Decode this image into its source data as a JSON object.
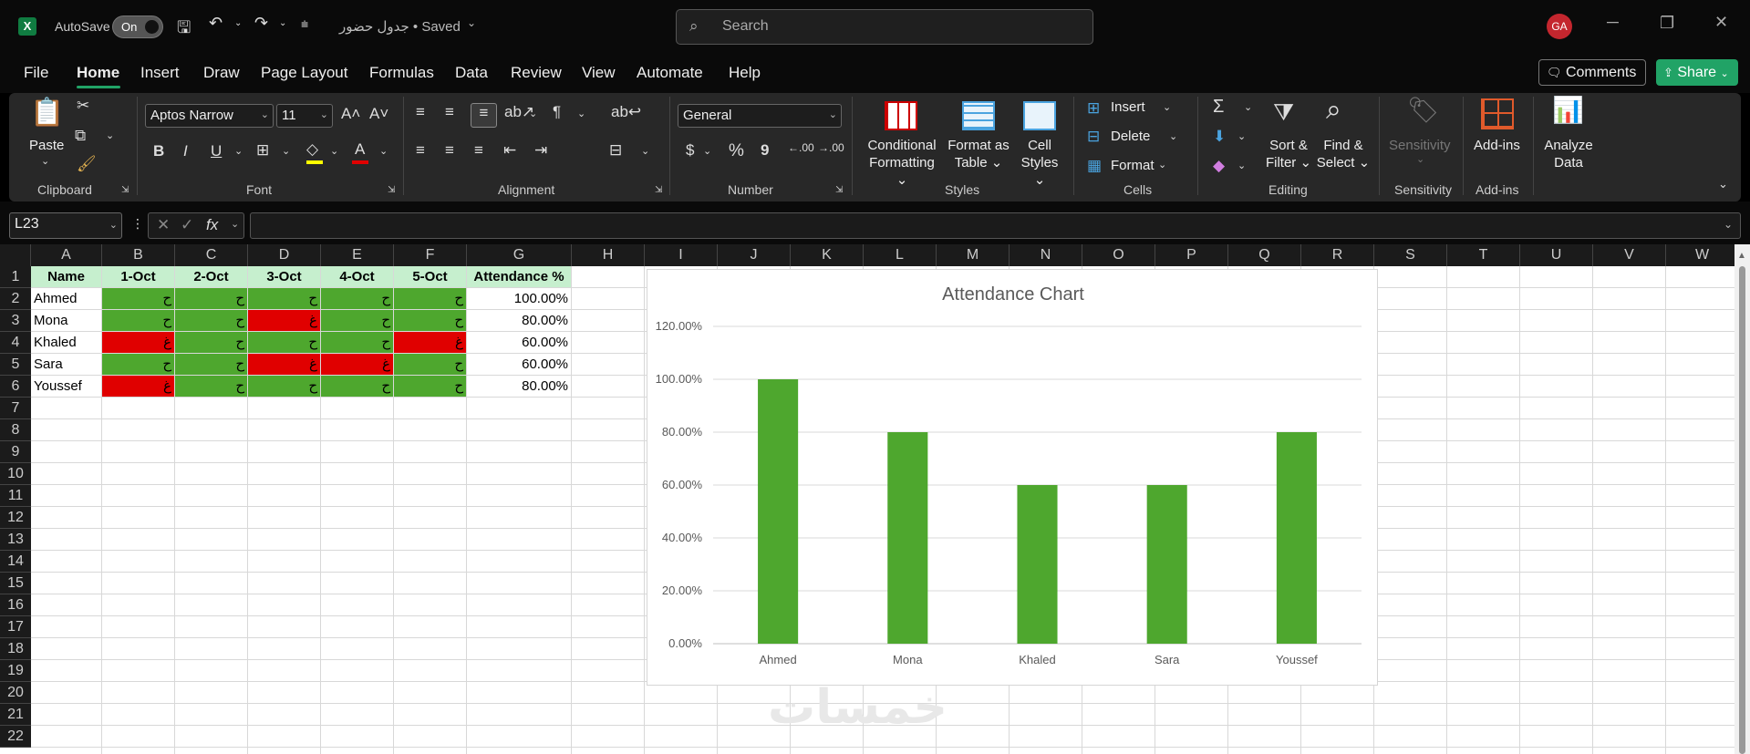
{
  "title_bar": {
    "autosave_label": "AutoSave",
    "autosave_state": "On",
    "document_title": "جدول حضور • Saved",
    "search_placeholder": "Search",
    "avatar_initials": "GA"
  },
  "menu": {
    "items": [
      "File",
      "Home",
      "Insert",
      "Draw",
      "Page Layout",
      "Formulas",
      "Data",
      "Review",
      "View",
      "Automate",
      "Help"
    ],
    "active": "Home",
    "comments_label": "Comments",
    "share_label": "Share"
  },
  "ribbon": {
    "clipboard": {
      "paste_label": "Paste",
      "group_label": "Clipboard"
    },
    "font": {
      "family": "Aptos Narrow",
      "size": "11",
      "group_label": "Font",
      "bold": "B",
      "italic": "I",
      "underline": "U"
    },
    "alignment": {
      "group_label": "Alignment"
    },
    "number": {
      "format": "General",
      "currency": "$",
      "percent": "%",
      "comma": "9",
      "inc_decimal": ".00",
      "dec_decimal": ".00",
      "group_label": "Number"
    },
    "styles": {
      "conditional_l1": "Conditional",
      "conditional_l2": "Formatting",
      "format_table_l1": "Format as",
      "format_table_l2": "Table",
      "cell_styles_l1": "Cell",
      "cell_styles_l2": "Styles",
      "group_label": "Styles"
    },
    "cells": {
      "insert": "Insert",
      "delete": "Delete",
      "format": "Format",
      "group_label": "Cells"
    },
    "editing": {
      "sort_l1": "Sort &",
      "sort_l2": "Filter",
      "find_l1": "Find &",
      "find_l2": "Select",
      "group_label": "Editing"
    },
    "sensitivity": {
      "label": "Sensitivity",
      "group_label": "Sensitivity"
    },
    "addins": {
      "label": "Add-ins",
      "group_label": "Add-ins"
    },
    "analyze": {
      "l1": "Analyze",
      "l2": "Data"
    }
  },
  "formula_bar": {
    "name_box": "L23",
    "fx": "fx",
    "formula": ""
  },
  "sheet": {
    "columns": [
      "A",
      "B",
      "C",
      "D",
      "E",
      "F",
      "G",
      "H",
      "I",
      "J",
      "K",
      "L",
      "M",
      "N",
      "O",
      "P",
      "Q",
      "R",
      "S",
      "T",
      "U",
      "V",
      "W"
    ],
    "rows": [
      "1",
      "2",
      "3",
      "4",
      "5",
      "6",
      "7",
      "8",
      "9",
      "10",
      "11",
      "12",
      "13",
      "14",
      "15",
      "16",
      "17",
      "18",
      "19",
      "20",
      "21",
      "22"
    ],
    "headers": [
      "Name",
      "1-Oct",
      "2-Oct",
      "3-Oct",
      "4-Oct",
      "5-Oct",
      "Attendance %"
    ],
    "present_mark": "ح",
    "absent_mark": "غ",
    "records": [
      {
        "name": "Ahmed",
        "days": [
          1,
          1,
          1,
          1,
          1
        ],
        "pct": "100.00%"
      },
      {
        "name": "Mona",
        "days": [
          1,
          1,
          0,
          1,
          1
        ],
        "pct": "80.00%"
      },
      {
        "name": "Khaled",
        "days": [
          0,
          1,
          1,
          1,
          0
        ],
        "pct": "60.00%"
      },
      {
        "name": "Sara",
        "days": [
          1,
          1,
          0,
          0,
          1
        ],
        "pct": "60.00%"
      },
      {
        "name": "Youssef",
        "days": [
          0,
          1,
          1,
          1,
          1
        ],
        "pct": "80.00%"
      }
    ],
    "colors": {
      "present": "#4ea72e",
      "absent": "#e00000",
      "header_fill": "#c6efce"
    }
  },
  "chart_data": {
    "type": "bar",
    "title": "Attendance Chart",
    "categories": [
      "Ahmed",
      "Mona",
      "Khaled",
      "Sara",
      "Youssef"
    ],
    "values": [
      100,
      80,
      60,
      60,
      80
    ],
    "ylim": [
      0,
      120
    ],
    "yticks": [
      "0.00%",
      "20.00%",
      "40.00%",
      "60.00%",
      "80.00%",
      "100.00%",
      "120.00%"
    ],
    "grid": true,
    "bar_color": "#4ea72e"
  },
  "watermark_text": "خمسات"
}
